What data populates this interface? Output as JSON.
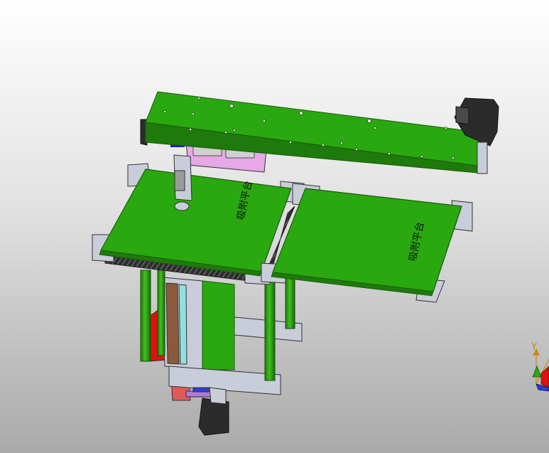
{
  "model": {
    "left_plate_label": "吸附平台",
    "right_plate_label": "吸附平台"
  },
  "triad": {
    "y_label": "Y"
  },
  "colors": {
    "plate_green": "#2aa80f",
    "plate_edge": "#1a5c0b",
    "steel": "#c9ccd9",
    "motor": "#2b2b2b",
    "pink_bracket": "#e6a8e6",
    "red_part": "#e01010",
    "carbon": "#2e2e2e"
  }
}
